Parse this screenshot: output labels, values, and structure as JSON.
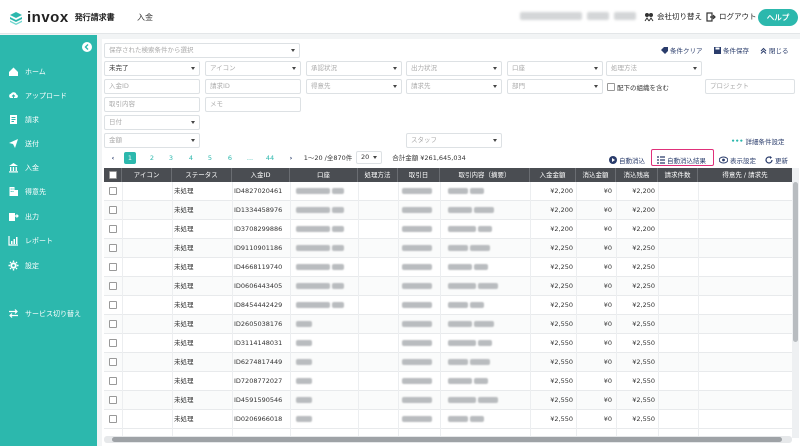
{
  "header": {
    "logo_text": "invox",
    "logo_sub": "発行請求書",
    "page_name": "入金",
    "switch_company": "会社切り替え",
    "logout": "ログアウト",
    "help": "ヘルプ"
  },
  "sidebar": {
    "items": [
      {
        "label": "ホーム",
        "icon": "home-icon"
      },
      {
        "label": "アップロード",
        "icon": "cloud-upload-icon"
      },
      {
        "label": "請求",
        "icon": "invoice-icon"
      },
      {
        "label": "送付",
        "icon": "send-icon"
      },
      {
        "label": "入金",
        "icon": "bank-icon"
      },
      {
        "label": "得意先",
        "icon": "building-icon"
      },
      {
        "label": "出力",
        "icon": "export-icon"
      },
      {
        "label": "レポート",
        "icon": "chart-icon"
      },
      {
        "label": "設定",
        "icon": "gear-icon"
      },
      {
        "label": "サービス切り替え",
        "icon": "switch-icon"
      }
    ]
  },
  "filters": {
    "saved_search_placeholder": "保存された検索条件から選択",
    "clear_conditions": "条件クリア",
    "save_conditions": "条件保存",
    "close": "閉じる",
    "status_value": "未完了",
    "icon_placeholder": "アイコン",
    "matching_status_placeholder": "承認状況",
    "output_status_placeholder": "出力状況",
    "account_placeholder": "口座",
    "processing_method_placeholder": "処理方法",
    "payment_id_placeholder": "入金ID",
    "invoice_id_placeholder": "請求ID",
    "customer_placeholder": "得意先",
    "billing_to_placeholder": "請求先",
    "department_placeholder": "部門",
    "include_sub_org": "配下の組織を含む",
    "project_placeholder": "プロジェクト",
    "transaction_placeholder": "取引内容",
    "memo_placeholder": "メモ",
    "date_placeholder": "日付",
    "amount_placeholder": "金額",
    "staff_placeholder": "スタッフ",
    "advanced_settings": "詳細条件設定"
  },
  "pagination": {
    "pages": [
      "1",
      "2",
      "3",
      "4",
      "5",
      "6",
      "...",
      "44"
    ],
    "range_text": "1〜20 /全870件",
    "per_page": "20",
    "total_label": "合計金額 ¥261,645,034"
  },
  "toolbar": {
    "auto_match": "自動消込",
    "auto_match_result": "自動消込結果",
    "display_settings": "表示設定",
    "refresh": "更新"
  },
  "table": {
    "headers": [
      "アイコン",
      "ステータス",
      "入金ID",
      "口座",
      "処理方法",
      "取引日",
      "取引内容（摘要）",
      "入金金額",
      "消込金額",
      "消込残高",
      "請求件数",
      "得意先 / 請求先"
    ],
    "rows": [
      {
        "status": "未処理",
        "id": "ID4827020461",
        "amount": "¥2,200",
        "cleared": "¥0",
        "balance": "¥2,200"
      },
      {
        "status": "未処理",
        "id": "ID1334458976",
        "amount": "¥2,200",
        "cleared": "¥0",
        "balance": "¥2,200"
      },
      {
        "status": "未処理",
        "id": "ID3708299886",
        "amount": "¥2,200",
        "cleared": "¥0",
        "balance": "¥2,200"
      },
      {
        "status": "未処理",
        "id": "ID9110901186",
        "amount": "¥2,250",
        "cleared": "¥0",
        "balance": "¥2,250"
      },
      {
        "status": "未処理",
        "id": "ID4668119740",
        "amount": "¥2,250",
        "cleared": "¥0",
        "balance": "¥2,250"
      },
      {
        "status": "未処理",
        "id": "ID0606443405",
        "amount": "¥2,250",
        "cleared": "¥0",
        "balance": "¥2,250"
      },
      {
        "status": "未処理",
        "id": "ID8454442429",
        "amount": "¥2,250",
        "cleared": "¥0",
        "balance": "¥2,250"
      },
      {
        "status": "未処理",
        "id": "ID2605038176",
        "amount": "¥2,550",
        "cleared": "¥0",
        "balance": "¥2,550"
      },
      {
        "status": "未処理",
        "id": "ID3114148031",
        "amount": "¥2,550",
        "cleared": "¥0",
        "balance": "¥2,550"
      },
      {
        "status": "未処理",
        "id": "ID6274817449",
        "amount": "¥2,550",
        "cleared": "¥0",
        "balance": "¥2,550"
      },
      {
        "status": "未処理",
        "id": "ID7208772027",
        "amount": "¥2,550",
        "cleared": "¥0",
        "balance": "¥2,550"
      },
      {
        "status": "未処理",
        "id": "ID4591590546",
        "amount": "¥2,550",
        "cleared": "¥0",
        "balance": "¥2,550"
      },
      {
        "status": "未処理",
        "id": "ID0206966018",
        "amount": "¥2,550",
        "cleared": "¥0",
        "balance": "¥2,550"
      }
    ]
  },
  "colors": {
    "brand": "#2cb8ad",
    "header_dark": "#4a4d52",
    "highlight": "#e0307a"
  }
}
